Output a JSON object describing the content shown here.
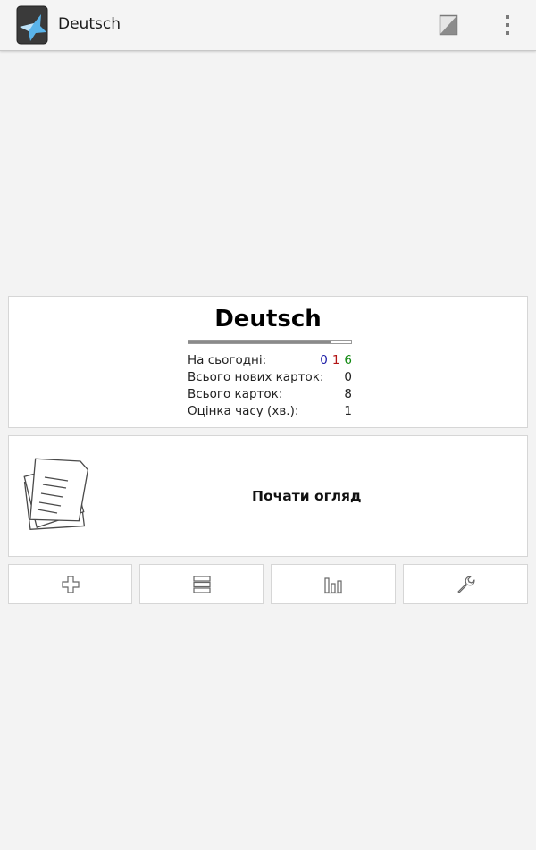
{
  "action_bar": {
    "title": "Deutsch",
    "edit_icon": "edit-note-icon",
    "overflow_icon": "overflow-menu-icon"
  },
  "deck": {
    "name": "Deutsch",
    "progress_fraction": 0.88,
    "stats": [
      {
        "label": "На сьогодні:",
        "counts": {
          "new": "0",
          "learn": "1",
          "review": "6"
        }
      },
      {
        "label": "Всього нових карток:",
        "value": "0"
      },
      {
        "label": "Всього карток:",
        "value": "8"
      },
      {
        "label": "Оцінка часу (хв.):",
        "value": "1"
      }
    ],
    "colors": {
      "new": "#1a1aa6",
      "learn": "#b31515",
      "review": "#138a13"
    }
  },
  "review": {
    "label": "Почати огляд",
    "icon": "cards-stack-icon"
  },
  "toolbar": {
    "buttons": [
      {
        "icon": "add-icon"
      },
      {
        "icon": "list-icon"
      },
      {
        "icon": "bar-chart-icon"
      },
      {
        "icon": "wrench-icon"
      }
    ]
  }
}
